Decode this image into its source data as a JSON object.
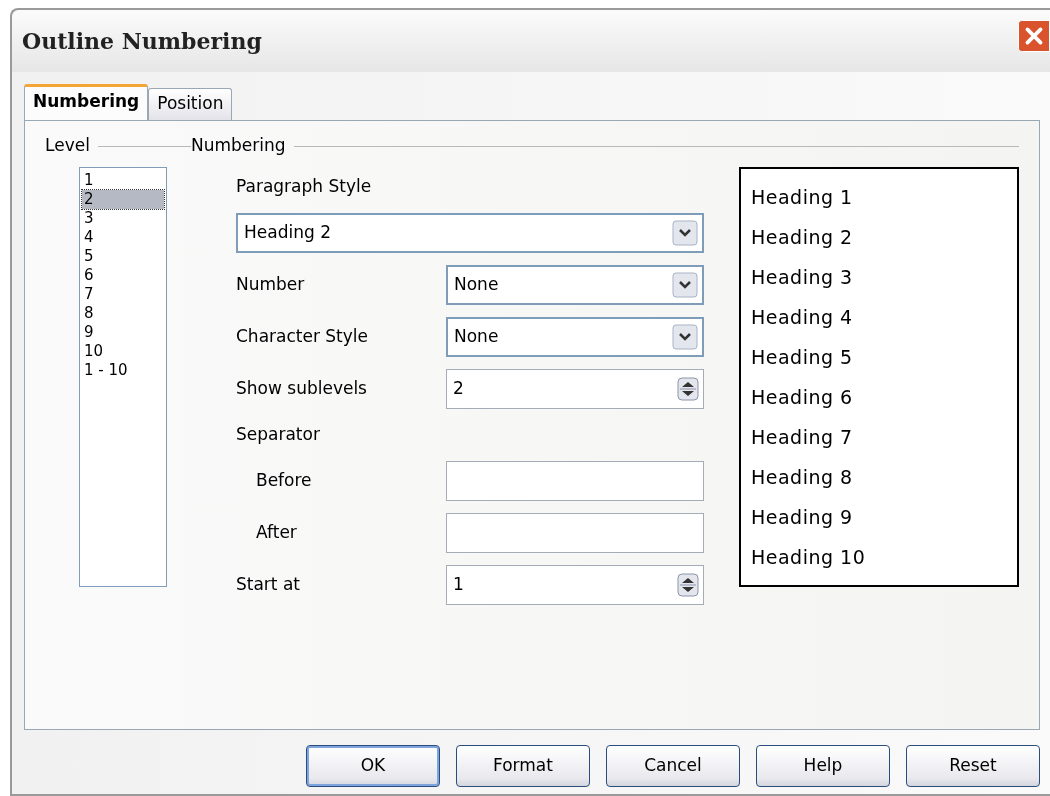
{
  "window": {
    "title": "Outline Numbering"
  },
  "tabs": [
    {
      "label": "Numbering",
      "selected": true
    },
    {
      "label": "Position",
      "selected": false
    }
  ],
  "level": {
    "legend": "Level",
    "items": [
      {
        "label": "1",
        "selected": false
      },
      {
        "label": "2",
        "selected": true
      },
      {
        "label": "3",
        "selected": false
      },
      {
        "label": "4",
        "selected": false
      },
      {
        "label": "5",
        "selected": false
      },
      {
        "label": "6",
        "selected": false
      },
      {
        "label": "7",
        "selected": false
      },
      {
        "label": "8",
        "selected": false
      },
      {
        "label": "9",
        "selected": false
      },
      {
        "label": "10",
        "selected": false
      },
      {
        "label": "1 - 10",
        "selected": false
      }
    ]
  },
  "numbering": {
    "legend": "Numbering",
    "fields": [
      {
        "kind": "wide_dropdown",
        "label": "Paragraph Style",
        "value": "Heading 2"
      },
      {
        "kind": "dropdown",
        "label": "Number",
        "value": "None"
      },
      {
        "kind": "dropdown",
        "label": "Character Style",
        "value": "None"
      },
      {
        "kind": "spin",
        "label": "Show sublevels",
        "value": "2"
      },
      {
        "kind": "group",
        "label": "Separator",
        "children": [
          {
            "kind": "text",
            "label": "Before"
          },
          {
            "kind": "text",
            "label": "After"
          }
        ]
      },
      {
        "kind": "spin",
        "label": "Start at",
        "value": "1"
      }
    ]
  },
  "preview": [
    "Heading 1",
    "Heading 2",
    "Heading 3",
    "Heading 4",
    "Heading 5",
    "Heading 6",
    "Heading 7",
    "Heading 8",
    "Heading 9",
    "Heading 10"
  ],
  "buttons": [
    {
      "label": "OK",
      "default": true
    },
    {
      "label": "Format",
      "default": false
    },
    {
      "label": "Cancel",
      "default": false
    },
    {
      "label": "Help",
      "default": false
    },
    {
      "label": "Reset",
      "default": false
    }
  ]
}
